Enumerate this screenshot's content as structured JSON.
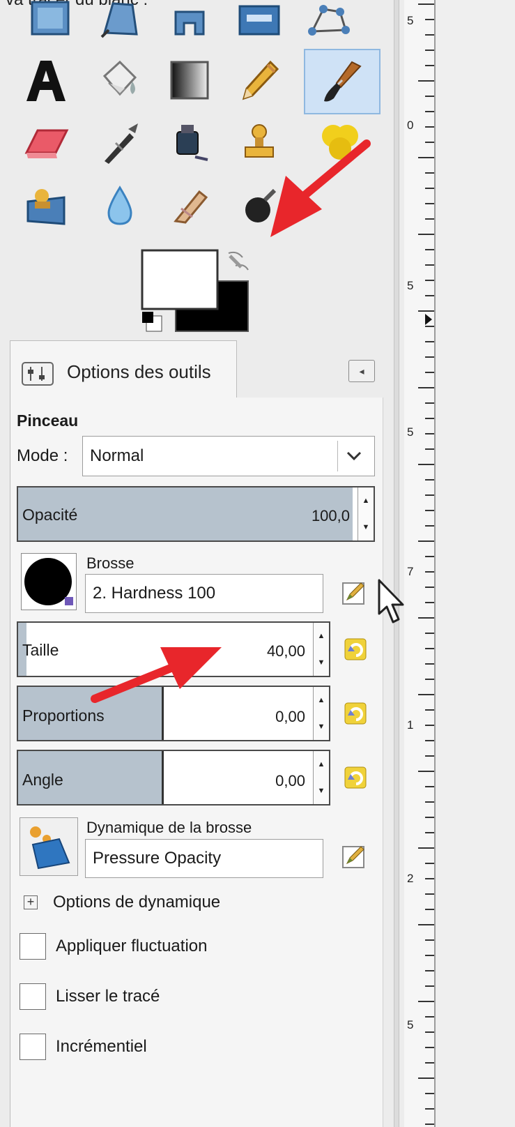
{
  "caption_fragment": "va tracer du blanc :",
  "toolbox": {
    "tools": [
      {
        "name": "rect-select-tool-icon"
      },
      {
        "name": "free-select-tool-icon"
      },
      {
        "name": "fuzzy-select-tool-icon"
      },
      {
        "name": "align-tool-icon"
      },
      {
        "name": "cage-transform-tool-icon"
      },
      {
        "name": "text-tool-icon"
      },
      {
        "name": "bucket-fill-tool-icon"
      },
      {
        "name": "blend-tool-icon"
      },
      {
        "name": "pencil-tool-icon"
      },
      {
        "name": "paintbrush-tool-icon",
        "active": true
      },
      {
        "name": "eraser-tool-icon"
      },
      {
        "name": "airbrush-tool-icon"
      },
      {
        "name": "ink-tool-icon"
      },
      {
        "name": "clone-tool-icon"
      },
      {
        "name": "heal-tool-icon"
      },
      {
        "name": "perspective-clone-tool-icon"
      },
      {
        "name": "blur-tool-icon"
      },
      {
        "name": "smudge-tool-icon"
      },
      {
        "name": "dodge-burn-tool-icon"
      }
    ],
    "foreground_color": "#ffffff",
    "background_color": "#000000"
  },
  "ruler": {
    "labels": [
      "5",
      "0",
      "5",
      "5",
      "7",
      "1",
      "2",
      "5"
    ]
  },
  "tool_options": {
    "tab_title": "Options des outils",
    "tool_name": "Pinceau",
    "mode_label": "Mode :",
    "mode_value": "Normal",
    "opacity": {
      "label": "Opacité",
      "value": "100,0",
      "fraction": 1.0
    },
    "brush_label": "Brosse",
    "brush_value": "2. Hardness 100",
    "size": {
      "label": "Taille",
      "value": "40,00"
    },
    "ratio": {
      "label": "Proportions",
      "value": "0,00"
    },
    "angle": {
      "label": "Angle",
      "value": "0,00"
    },
    "dynamics_label": "Dynamique de la brosse",
    "dynamics_value": "Pressure Opacity",
    "dynamics_options_label": "Options de dynamique",
    "apply_jitter_label": "Appliquer fluctuation",
    "smooth_stroke_label": "Lisser le tracé",
    "incremental_label": "Incrémentiel"
  },
  "annotation_color": "#e8262b"
}
